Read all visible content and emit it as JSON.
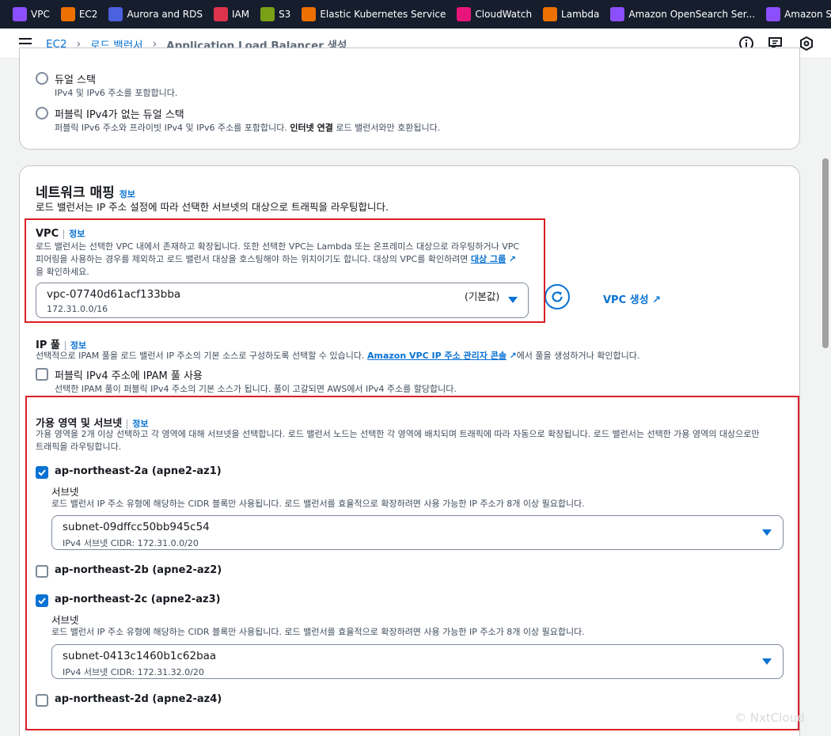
{
  "favorites": [
    {
      "label": "VPC",
      "icon": "vpc-icon",
      "color": "#8c4fff"
    },
    {
      "label": "EC2",
      "icon": "ec2-icon",
      "color": "#ed7100"
    },
    {
      "label": "Aurora and RDS",
      "icon": "rds-icon",
      "color": "#4b61dd"
    },
    {
      "label": "IAM",
      "icon": "iam-icon",
      "color": "#dd344c"
    },
    {
      "label": "S3",
      "icon": "s3-icon",
      "color": "#7aa116"
    },
    {
      "label": "Elastic Kubernetes Service",
      "icon": "eks-icon",
      "color": "#ed7100"
    },
    {
      "label": "CloudWatch",
      "icon": "cloudwatch-icon",
      "color": "#e7157b"
    },
    {
      "label": "Lambda",
      "icon": "lambda-icon",
      "color": "#ed7100"
    },
    {
      "label": "Amazon OpenSearch Ser...",
      "icon": "opensearch-icon",
      "color": "#8c4fff"
    },
    {
      "label": "Amazon S...",
      "icon": "amazon-icon",
      "color": "#8c4fff"
    }
  ],
  "breadcrumb": {
    "ec2": "EC2",
    "lb": "로드 밸런서",
    "current": "Application Load Balancer 생성"
  },
  "ip_type": {
    "dual": {
      "label": "듀얼 스택",
      "desc": "IPv4 및 IPv6 주소를 포함합니다."
    },
    "dual_no_public": {
      "label": "퍼블릭 IPv4가 없는 듀얼 스택",
      "desc_pre": "퍼블릭 IPv6 주소와 프라이빗 IPv4 및 IPv6 주소를 포함합니다. ",
      "desc_bold": "인터넷 연결",
      "desc_post": " 로드 밸런서와만 호환됩니다."
    }
  },
  "network": {
    "title": "네트워크 매핑",
    "info": "정보",
    "desc": "로드 밸런서는 IP 주소 설정에 따라 선택한 서브넷의 대상으로 트래픽을 라우팅합니다."
  },
  "vpc": {
    "label": "VPC",
    "info": "정보",
    "desc_line1": "로드 밸런서는 선택한 VPC 내에서 존재하고 확장됩니다. 또한 선택한 VPC는 Lambda 또는 온프레미스 대상으로 라우팅하거나 VPC",
    "desc_line2": "피어링을 사용하는 경우를 제외하고 로드 밸런서 대상을 호스팅해야 하는 위치이기도 합니다. 대상의 VPC를 확인하려면 ",
    "target_group_link": "대상 그룹",
    "desc_line3": "을 확인하세요.",
    "selected": "vpc-07740d61acf133bba",
    "cidr": "172.31.0.0/16",
    "default_tag": "(기본값)",
    "create_label": "VPC 생성"
  },
  "ipam": {
    "label": "IP 풀",
    "info": "정보",
    "desc_pre": "선택적으로 IPAM 풀을 로드 밸런서 IP 주소의 기본 소스로 구성하도록 선택할 수 있습니다. ",
    "console_link": "Amazon VPC IP 주소 관리자 콘솔",
    "desc_post": "에서 풀을 생성하거나 확인합니다.",
    "checkbox_label": "퍼블릭 IPv4 주소에 IPAM 풀 사용",
    "checkbox_desc": "선택한 IPAM 풀이 퍼블릭 IPv4 주소의 기본 소스가 됩니다. 풀이 고갈되면 AWS에서 IPv4 주소를 할당합니다."
  },
  "az": {
    "label": "가용 영역 및 서브넷",
    "info": "정보",
    "desc_line1": "가용 영역을 2개 이상 선택하고 각 영역에 대해 서브넷을 선택합니다. 로드 밸런서 노드는 선택한 각 영역에 배치되며 트래픽에 따라 자동으로 확장됩니다. 로드 밸런서는 선택한 가용 영역의 대상으로만",
    "desc_line2": "트래픽을 라우팅합니다.",
    "subnet_label": "서브넷",
    "subnet_desc": "로드 밸런서 IP 주소 유형에 해당하는 CIDR 블록만 사용됩니다. 로드 밸런서를 효율적으로 확장하려면 사용 가능한 IP 주소가 8개 이상 필요합니다.",
    "zones": [
      {
        "label": "ap-northeast-2a (apne2-az1)",
        "checked": true,
        "subnet": "subnet-09dffcc50bb945c54",
        "subnet_cidr": "IPv4 서브넷 CIDR: 172.31.0.0/20"
      },
      {
        "label": "ap-northeast-2b (apne2-az2)",
        "checked": false
      },
      {
        "label": "ap-northeast-2c (apne2-az3)",
        "checked": true,
        "subnet": "subnet-0413c1460b1c62baa",
        "subnet_cidr": "IPv4 서브넷 CIDR: 172.31.32.0/20"
      },
      {
        "label": "ap-northeast-2d (apne2-az4)",
        "checked": false
      }
    ]
  },
  "watermark": "© NxtCloud",
  "colors": {
    "accent": "#0972d3",
    "highlight": "#d91f26",
    "topbar": "#161e2d"
  }
}
